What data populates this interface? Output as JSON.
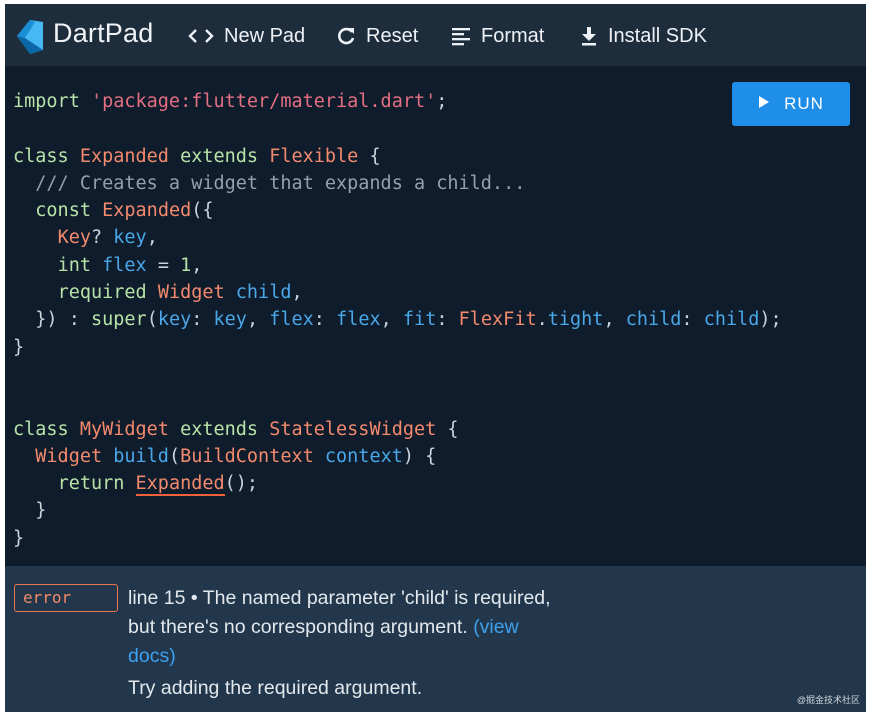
{
  "header": {
    "brand": "DartPad",
    "new_pad_label": "New Pad",
    "reset_label": "Reset",
    "format_label": "Format",
    "install_sdk_label": "Install SDK",
    "icons": [
      "dart-logo-icon",
      "code-brackets-icon",
      "refresh-icon",
      "format-lines-icon",
      "download-icon"
    ]
  },
  "editor": {
    "run_label": "RUN",
    "lines": [
      "import 'package:flutter/material.dart';",
      "",
      "class Expanded extends Flexible {",
      "  /// Creates a widget that expands a child...",
      "  const Expanded({",
      "    Key? key,",
      "    int flex = 1,",
      "    required Widget child,",
      "  }) : super(key: key, flex: flex, fit: FlexFit.tight, child: child);",
      "}",
      "",
      "",
      "class MyWidget extends StatelessWidget {",
      "  Widget build(BuildContext context) {",
      "    return Expanded();",
      "  }",
      "}"
    ]
  },
  "problems": {
    "badge": "error",
    "message_line1": "line 15 • The named parameter 'child' is required,",
    "message_line2": "but there's no corresponding argument.",
    "view_docs": "(view docs)",
    "hint": "Try adding the required argument."
  },
  "watermark": "@掘金技术社区",
  "colors": {
    "header_bg": "#1d2d3b",
    "editor_bg": "#0f1c2b",
    "problems_bg": "#22374c",
    "run_button": "#1f8ee8",
    "error_accent": "#f0623c"
  }
}
